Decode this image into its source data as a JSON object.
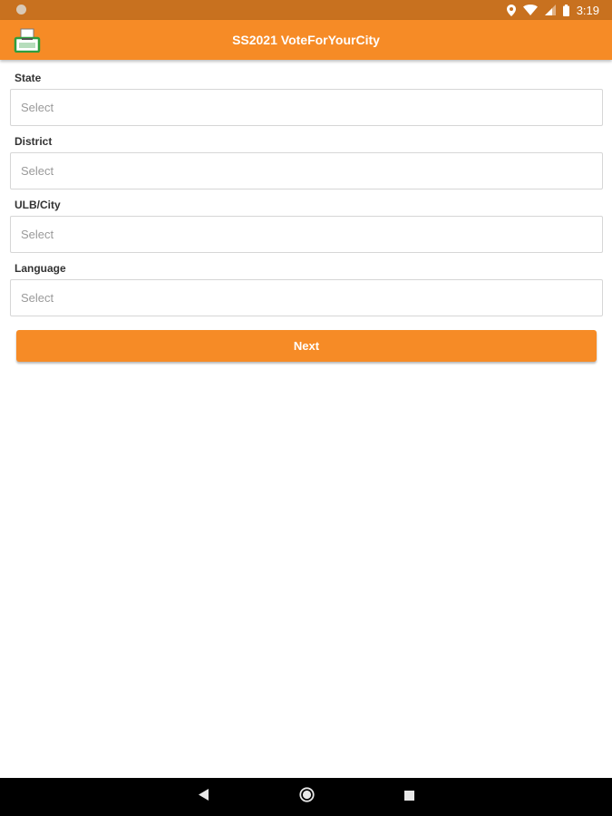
{
  "status_bar": {
    "time": "3:19",
    "icons": [
      "location-icon",
      "wifi-icon",
      "signal-icon",
      "battery-icon"
    ]
  },
  "app_bar": {
    "title": "SS2021 VoteForYourCity",
    "logo_icon": "ballot-box-icon"
  },
  "form": {
    "fields": [
      {
        "label": "State",
        "placeholder": "Select"
      },
      {
        "label": "District",
        "placeholder": "Select"
      },
      {
        "label": "ULB/City",
        "placeholder": "Select"
      },
      {
        "label": "Language",
        "placeholder": "Select"
      }
    ],
    "next_label": "Next"
  },
  "nav_bar": {
    "icons": [
      "back-icon",
      "home-icon",
      "recents-icon"
    ]
  },
  "colors": {
    "status_bar": "#c8711f",
    "accent": "#f68b26",
    "logo_green": "#2e9e3e"
  }
}
